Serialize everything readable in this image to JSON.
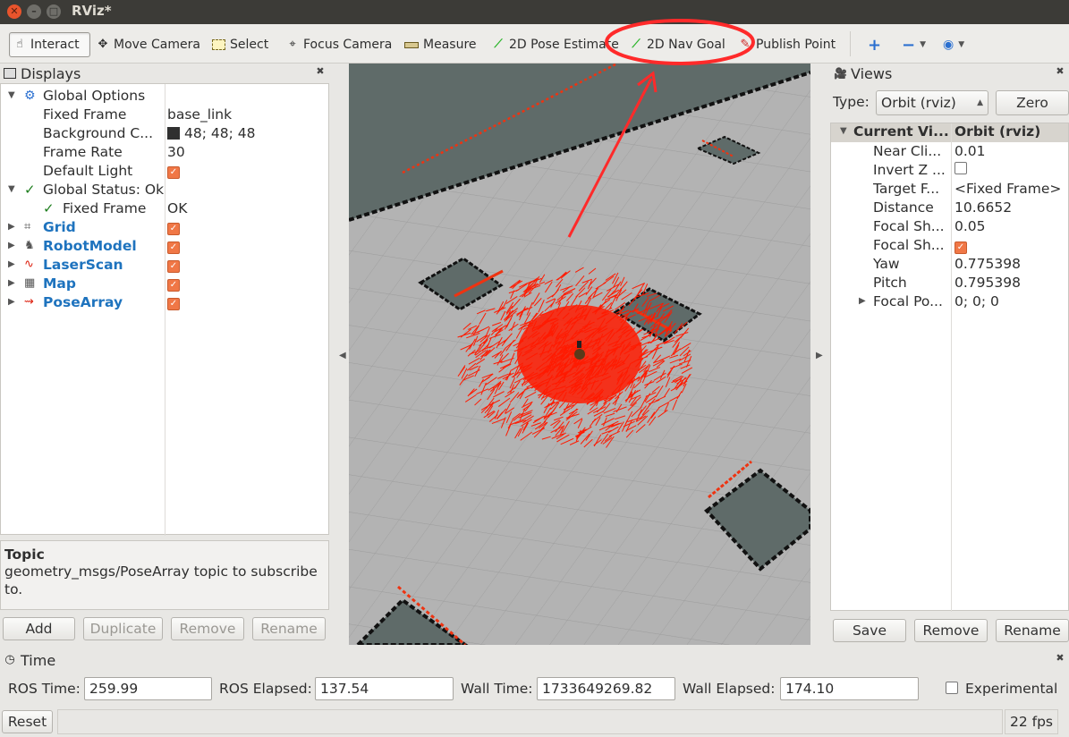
{
  "window": {
    "title": "RViz*"
  },
  "toolbar": {
    "interact": "Interact",
    "move_camera": "Move Camera",
    "select": "Select",
    "focus_camera": "Focus Camera",
    "measure": "Measure",
    "pose_estimate": "2D Pose Estimate",
    "nav_goal": "2D Nav Goal",
    "publish_point": "Publish Point"
  },
  "displays": {
    "title": "Displays",
    "global_options": "Global Options",
    "fixed_frame_label": "Fixed Frame",
    "fixed_frame_value": "base_link",
    "background_label": "Background C...",
    "background_value": "48; 48; 48",
    "frame_rate_label": "Frame Rate",
    "frame_rate_value": "30",
    "default_light_label": "Default Light",
    "global_status": "Global Status: Ok",
    "status_fixed_frame_label": "Fixed Frame",
    "status_fixed_frame_value": "OK",
    "items": [
      "Grid",
      "RobotModel",
      "LaserScan",
      "Map",
      "PoseArray"
    ],
    "topic_title": "Topic",
    "topic_desc": "geometry_msgs/PoseArray topic to subscribe to.",
    "buttons": {
      "add": "Add",
      "duplicate": "Duplicate",
      "remove": "Remove",
      "rename": "Rename"
    }
  },
  "views": {
    "title": "Views",
    "type_label": "Type:",
    "type_value": "Orbit (rviz)",
    "zero": "Zero",
    "header_label": "Current Vi...",
    "header_value": "Orbit (rviz)",
    "near_clip_label": "Near Cli...",
    "near_clip_value": "0.01",
    "invert_z_label": "Invert Z ...",
    "target_frame_label": "Target F...",
    "target_frame_value": "<Fixed Frame>",
    "distance_label": "Distance",
    "distance_value": "10.6652",
    "focal_shape_size_label": "Focal Sh...",
    "focal_shape_size_value": "0.05",
    "focal_shape_fixed_label": "Focal Sh...",
    "yaw_label": "Yaw",
    "yaw_value": "0.775398",
    "pitch_label": "Pitch",
    "pitch_value": "0.795398",
    "focal_point_label": "Focal Po...",
    "focal_point_value": "0; 0; 0",
    "buttons": {
      "save": "Save",
      "remove": "Remove",
      "rename": "Rename"
    }
  },
  "time": {
    "title": "Time",
    "ros_time_label": "ROS Time:",
    "ros_time_value": "259.99",
    "ros_elapsed_label": "ROS Elapsed:",
    "ros_elapsed_value": "137.54",
    "wall_time_label": "Wall Time:",
    "wall_time_value": "1733649269.82",
    "wall_elapsed_label": "Wall Elapsed:",
    "wall_elapsed_value": "174.10",
    "experimental_label": "Experimental"
  },
  "status": {
    "reset": "Reset",
    "fps": "22 fps"
  },
  "colors": {
    "accent_orange": "#f07746",
    "display_blue": "#1e73be",
    "annotation_red": "#ff2a2a",
    "particles": "#ff1a00"
  }
}
